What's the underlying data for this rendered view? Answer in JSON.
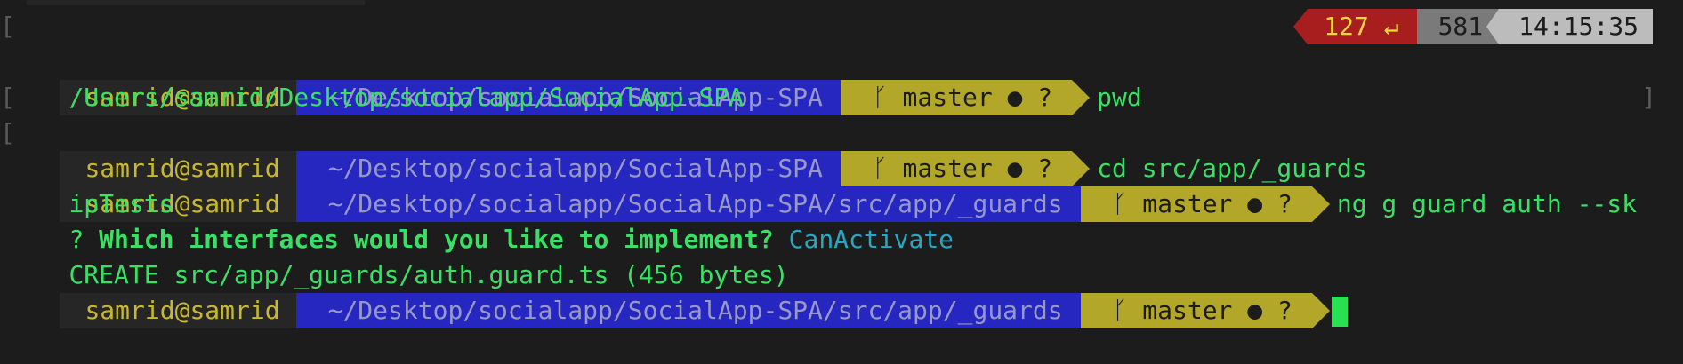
{
  "colors": {
    "background": "#1c1c1c",
    "dir_segment": "#2626c0",
    "git_segment": "#b3a72a",
    "command": "#3ae066",
    "error": "#a81e1e",
    "answer": "#25a8c0"
  },
  "prompt": {
    "context": "samrid@samrid",
    "dir_root": "~/Desktop/socialapp/SocialApp-SPA",
    "dir_guards": "~/Desktop/socialapp/SocialApp-SPA/src/app/_guards",
    "branch_icon": "branch-icon",
    "branch": "ᚴ master ● ?"
  },
  "lines": {
    "l1_cmd": "pwd",
    "l1_status": "127 ↵",
    "l1_hist": "581",
    "l1_time": "14:15:35",
    "l2_output": "/Users/samrid/Desktop/socialapp/SocialApp-SPA",
    "l3_cmd": "cd src/app/_guards",
    "l4_cmd": "ng g guard auth --sk",
    "l5_wrap": "ipTests",
    "l6_mark": "?",
    "l6_question": "Which interfaces would you like to implement?",
    "l6_answer": "CanActivate",
    "l7_action": "CREATE",
    "l7_path": "src/app/_guards/auth.guard.ts (456 bytes)"
  },
  "brackets": {
    "left": "[",
    "right": "]"
  }
}
